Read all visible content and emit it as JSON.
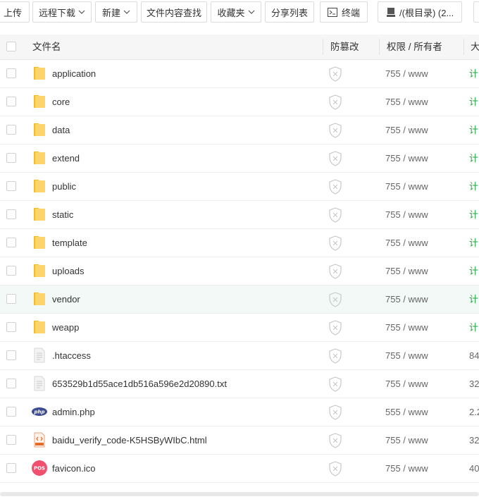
{
  "toolbar": {
    "upload": "上传",
    "remote_download": "远程下载",
    "new": "新建",
    "content_search": "文件内容查找",
    "favorites": "收藏夹",
    "share_list": "分享列表",
    "terminal": "终端",
    "path": "/(根目录) (2..."
  },
  "table": {
    "headers": {
      "name": "文件名",
      "tamper": "防篡改",
      "perm": "权限 / 所有者",
      "size": "大"
    },
    "rows": [
      {
        "name": "application",
        "icon": "folder-icon",
        "perm": "755 / www",
        "size": "计",
        "size_color": "#20a53a"
      },
      {
        "name": "core",
        "icon": "folder-icon",
        "perm": "755 / www",
        "size": "计",
        "size_color": "#20a53a"
      },
      {
        "name": "data",
        "icon": "folder-icon",
        "perm": "755 / www",
        "size": "计",
        "size_color": "#20a53a"
      },
      {
        "name": "extend",
        "icon": "folder-icon",
        "perm": "755 / www",
        "size": "计",
        "size_color": "#20a53a"
      },
      {
        "name": "public",
        "icon": "folder-icon",
        "perm": "755 / www",
        "size": "计",
        "size_color": "#20a53a"
      },
      {
        "name": "static",
        "icon": "folder-icon",
        "perm": "755 / www",
        "size": "计",
        "size_color": "#20a53a"
      },
      {
        "name": "template",
        "icon": "folder-icon",
        "perm": "755 / www",
        "size": "计",
        "size_color": "#20a53a"
      },
      {
        "name": "uploads",
        "icon": "folder-icon",
        "perm": "755 / www",
        "size": "计",
        "size_color": "#20a53a"
      },
      {
        "name": "vendor",
        "icon": "folder-icon",
        "perm": "755 / www",
        "size": "计",
        "size_color": "#20a53a"
      },
      {
        "name": "weapp",
        "icon": "folder-icon",
        "perm": "755 / www",
        "size": "计",
        "size_color": "#20a53a"
      },
      {
        "name": ".htaccess",
        "icon": "text-file-icon",
        "perm": "755 / www",
        "size": "84",
        "size_color": "#666666"
      },
      {
        "name": "653529b1d55ace1db516a596e2d20890.txt",
        "icon": "text-file-icon",
        "perm": "755 / www",
        "size": "32",
        "size_color": "#666666"
      },
      {
        "name": "admin.php",
        "icon": "php-file-icon",
        "perm": "555 / www",
        "size": "2.2",
        "size_color": "#666666"
      },
      {
        "name": "baidu_verify_code-K5HSByWIbC.html",
        "icon": "html-file-icon",
        "perm": "755 / www",
        "size": "32",
        "size_color": "#666666"
      },
      {
        "name": "favicon.ico",
        "icon": "ico-file-icon",
        "perm": "755 / www",
        "size": "40",
        "size_color": "#666666"
      }
    ],
    "highlighted_row": "vendor"
  },
  "colors": {
    "green": "#20a53a",
    "folder": "#f9c440",
    "highlight": "#f2f9f7"
  }
}
